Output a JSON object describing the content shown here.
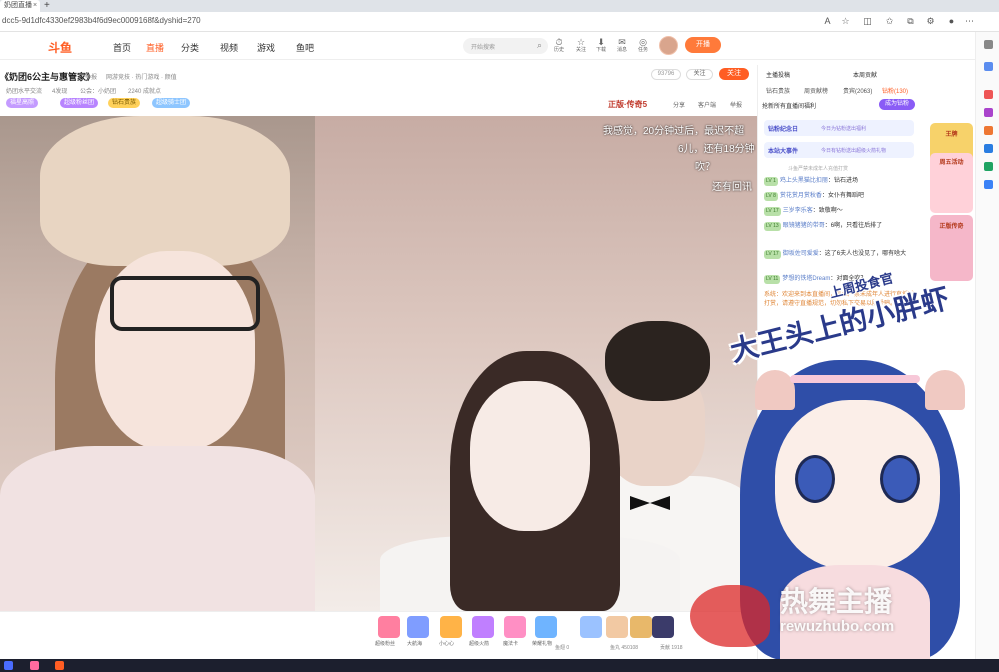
{
  "browser": {
    "tab_title": "奶团直播",
    "tab_close": "×",
    "new_tab": "+",
    "url": "dcc5-9d1dfc4330ef2983b4f6d9ec0009168f&dyshid=270",
    "icons": [
      "read-aloud-icon",
      "favorite-icon",
      "split-icon",
      "collections-icon",
      "extensions-icon",
      "profile-icon",
      "more-icon"
    ]
  },
  "site": {
    "logo": "斗鱼",
    "nav": [
      "首页",
      "直播",
      "分类",
      "视频",
      "游戏",
      "鱼吧"
    ],
    "nav_active": "直播",
    "search_placeholder": "开始搜索",
    "top_icons": [
      {
        "glyph": "⏱",
        "label": "历史"
      },
      {
        "glyph": "☆",
        "label": "关注"
      },
      {
        "glyph": "⬇",
        "label": "下载"
      },
      {
        "glyph": "✉",
        "label": "消息"
      },
      {
        "glyph": "◎",
        "label": "任务"
      }
    ],
    "open_btn": "开播"
  },
  "room": {
    "title": "《奶团6公主与惠管家》",
    "meta_top": [
      "举报",
      "网游竞技 · 热门游戏 · 颜值"
    ],
    "meta_row2": [
      "奶团水平交流",
      "4发现",
      "公会：小奶团",
      "2240 成就点"
    ],
    "badges": [
      {
        "text": "福星高照",
        "color": "#c49bff"
      },
      {
        "text": "超级粉丝团",
        "color": "#b884ff"
      },
      {
        "text": "钻石贵族",
        "color": "#ffd15a"
      },
      {
        "text": "超级骑士团",
        "color": "#8ec6ff"
      }
    ],
    "follow_count": "93796",
    "fans_label": "关注",
    "follow_btn": "关注",
    "event_text": "正版·传奇5",
    "tools": [
      "分享",
      "客户端",
      "举报"
    ]
  },
  "video": {
    "subtitles": [
      "我感觉，20分钟过后，最迟不超",
      "6儿，还有18分钟",
      "吹？",
      "还有回讯"
    ]
  },
  "mascot": {
    "title_big": "大王头上的小胖虾",
    "title_small": "上周投食官"
  },
  "watermark": {
    "cn": "热舞主播",
    "en": "rewuzhubo.com"
  },
  "gifts": [
    {
      "label": "超级粉丝",
      "color": "#ff7fa0"
    },
    {
      "label": "大航海",
      "color": "#7f9dff"
    },
    {
      "label": "小心心",
      "color": "#ffb347"
    },
    {
      "label": "超级火箭",
      "color": "#c07fff"
    },
    {
      "label": "魔法卡",
      "color": "#ff8fc4"
    },
    {
      "label": "荣耀礼物",
      "color": "#6fb4ff"
    }
  ],
  "bottom_stats": [
    "鱼翅 0",
    "鱼丸 450108",
    "贡献 1918"
  ],
  "chat": {
    "rank_tabs": [
      "主播投稿",
      "本周贡献"
    ],
    "sub_tabs": [
      "钻石贵族",
      "周贡献榜",
      "贵宾(2063)",
      "钻粉(130)"
    ],
    "sub_active": "钻粉(130)",
    "fanwall_text": "抢新所有直播间福利",
    "fan_btn": "成为钻粉",
    "cards": [
      {
        "t1": "钻粉纪念日",
        "t2": "今日为钻粉送出福利"
      },
      {
        "t1": "本站大事件",
        "t2": "今日有钻粉送出超级火箭礼物"
      }
    ],
    "notice": "斗鱼严禁未成年人充值打赏",
    "messages": [
      {
        "level": "LV 1",
        "name": "鸡上头黑猫比扣丽",
        "text": "钻石进场",
        "sys": false
      },
      {
        "level": "LV 8",
        "name": "赏花赏月赏秋香",
        "text": "女仆有舞蹈吧",
        "sys": false
      },
      {
        "level": "LV 17",
        "name": "三岁李乐客",
        "text": "致敬啊～",
        "sys": false
      },
      {
        "level": "LV 13",
        "name": "眼镜猪猪的带哥",
        "text": "6啊，只看往后排了",
        "sys": false
      },
      {
        "level": "LV 17",
        "name": "御坂佐司爱爱",
        "text": "这了6夫人也没见了，哪有啥大",
        "sys": false
      },
      {
        "level": "LV 11",
        "name": "梦想的铁塔Dream",
        "text": "对面全吹？",
        "sys": false
      },
      {
        "level": "",
        "name": "系统",
        "text": "欢迎来到本直播间，斗鱼严禁未成年人进行直播或打赏，请遵守直播规范，切勿私下交易以防受骗。",
        "sys": true
      }
    ]
  },
  "promo": [
    {
      "text": "王牌",
      "color": "#f7d26a"
    },
    {
      "text": "周五活动",
      "color": "#ffd1d9"
    },
    {
      "text": "正版传奇",
      "color": "#f5b7c9"
    }
  ]
}
